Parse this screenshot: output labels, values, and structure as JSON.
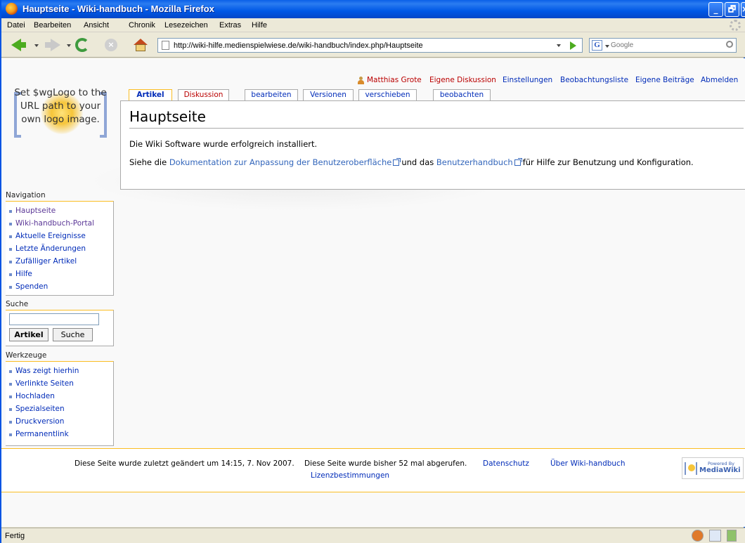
{
  "window": {
    "title": "Hauptseite - Wiki-handbuch - Mozilla Firefox",
    "controls": [
      "_",
      "🗗",
      "×"
    ]
  },
  "menubar": {
    "items": [
      "Datei",
      "Bearbeiten",
      "Ansicht",
      "Chronik",
      "Lesezeichen",
      "Extras",
      "Hilfe"
    ]
  },
  "toolbar": {
    "url": "http://wiki-hilfe.medienspielwiese.de/wiki-handbuch/index.php/Hauptseite",
    "search_engine": "G",
    "search_placeholder": "Google",
    "stop_glyph": "×"
  },
  "logo": {
    "text": "Set $wgLogo to the URL path to your own logo image."
  },
  "personal": {
    "user": "Matthias Grote",
    "talk": "Eigene Diskussion",
    "preferences": "Einstellungen",
    "watchlist": "Beobachtungsliste",
    "contributions": "Eigene Beiträge",
    "logout": "Abmelden"
  },
  "tabs": {
    "article": "Artikel",
    "discussion": "Diskussion",
    "edit": "bearbeiten",
    "history": "Versionen",
    "move": "verschieben",
    "watch": "beobachten"
  },
  "content": {
    "heading": "Hauptseite",
    "line1": "Die Wiki Software wurde erfolgreich installiert.",
    "line2_pre": "Siehe die",
    "line2_link1": "Dokumentation zur Anpassung der Benutzeroberfläche",
    "line2_mid": "und das",
    "line2_link2": "Benutzerhandbuch",
    "line2_post": "für Hilfe zur Benutzung und Konfiguration."
  },
  "navigation": {
    "title": "Navigation",
    "items": [
      "Hauptseite",
      "Wiki-handbuch-Portal",
      "Aktuelle Ereignisse",
      "Letzte Änderungen",
      "Zufälliger Artikel",
      "Hilfe",
      "Spenden"
    ]
  },
  "search": {
    "title": "Suche",
    "go_button": "Artikel",
    "search_button": "Suche",
    "value": ""
  },
  "toolbox": {
    "title": "Werkzeuge",
    "items": [
      "Was zeigt hierhin",
      "Verlinkte Seiten",
      "Hochladen",
      "Spezialseiten",
      "Druckversion",
      "Permanentlink"
    ]
  },
  "footer": {
    "lastmod": "Diese Seite wurde zuletzt geändert um 14:15, 7. Nov 2007.",
    "viewcount": "Diese Seite wurde bisher 52 mal abgerufen.",
    "privacy": "Datenschutz",
    "about": "Über Wiki-handbuch",
    "disclaimer": "Lizenzbestimmungen",
    "powered_small": "Powered By",
    "powered_big": "MediaWiki"
  },
  "statusbar": {
    "text": "Fertig"
  },
  "colors": {
    "link": "#002bb8",
    "new_link": "#ba0000",
    "external_link": "#3366bb",
    "accent_border": "#fabd23",
    "titlebar": "#0058e6"
  },
  "icons": [
    "firefox-icon",
    "back-icon",
    "forward-icon",
    "reload-icon",
    "stop-icon",
    "home-icon",
    "page-icon",
    "go-icon",
    "google-icon",
    "magnifier-icon",
    "user-icon",
    "external-link-icon",
    "mediawiki-logo-icon",
    "throbber-icon"
  ]
}
